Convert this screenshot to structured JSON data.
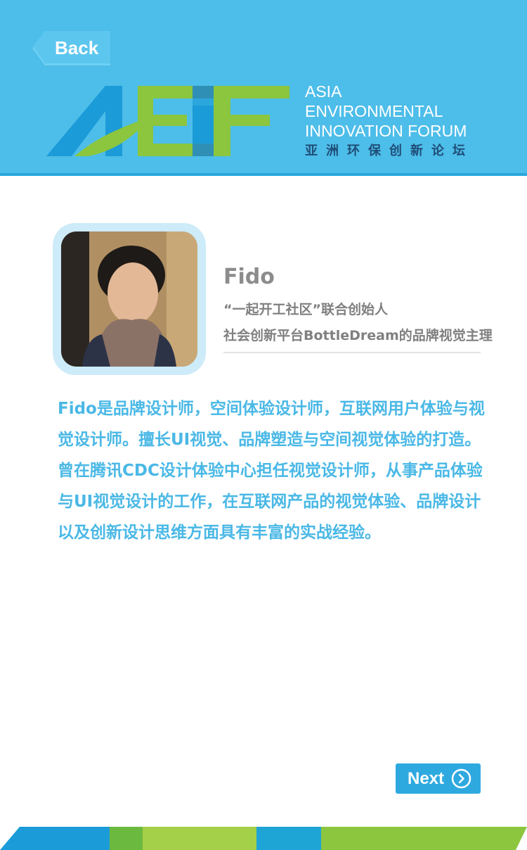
{
  "header": {
    "back_label": "Back",
    "logo": {
      "line1": "ASIA",
      "line2": "ENVIRONMENTAL",
      "line3": "INNOVATION FORUM",
      "chinese": "亚洲环保创新论坛"
    }
  },
  "profile": {
    "name": "Fido",
    "title1": "“一起开工社区”联合创始人",
    "title2": "社会创新平台BottleDream的品牌视觉主理",
    "bio": "Fido是品牌设计师，空间体验设计师，互联网用户体验与视觉设计师。擅长UI视觉、品牌塑造与空间视觉体验的打造。曾在腾讯CDC设计体验中心担任视觉设计师，从事产品体验与UI视觉设计的工作，在互联网产品的视觉体验、品牌设计以及创新设计思维方面具有丰富的实战经验。"
  },
  "footer": {
    "next_label": "Next"
  },
  "icons": {
    "back": "back-arrow-icon",
    "next": "chevron-right-circle-icon"
  },
  "colors": {
    "header_bg": "#4dbde9",
    "accent_blue": "#2ea9e0",
    "bio_text": "#4ab8e6",
    "green": "#8cc63f"
  }
}
